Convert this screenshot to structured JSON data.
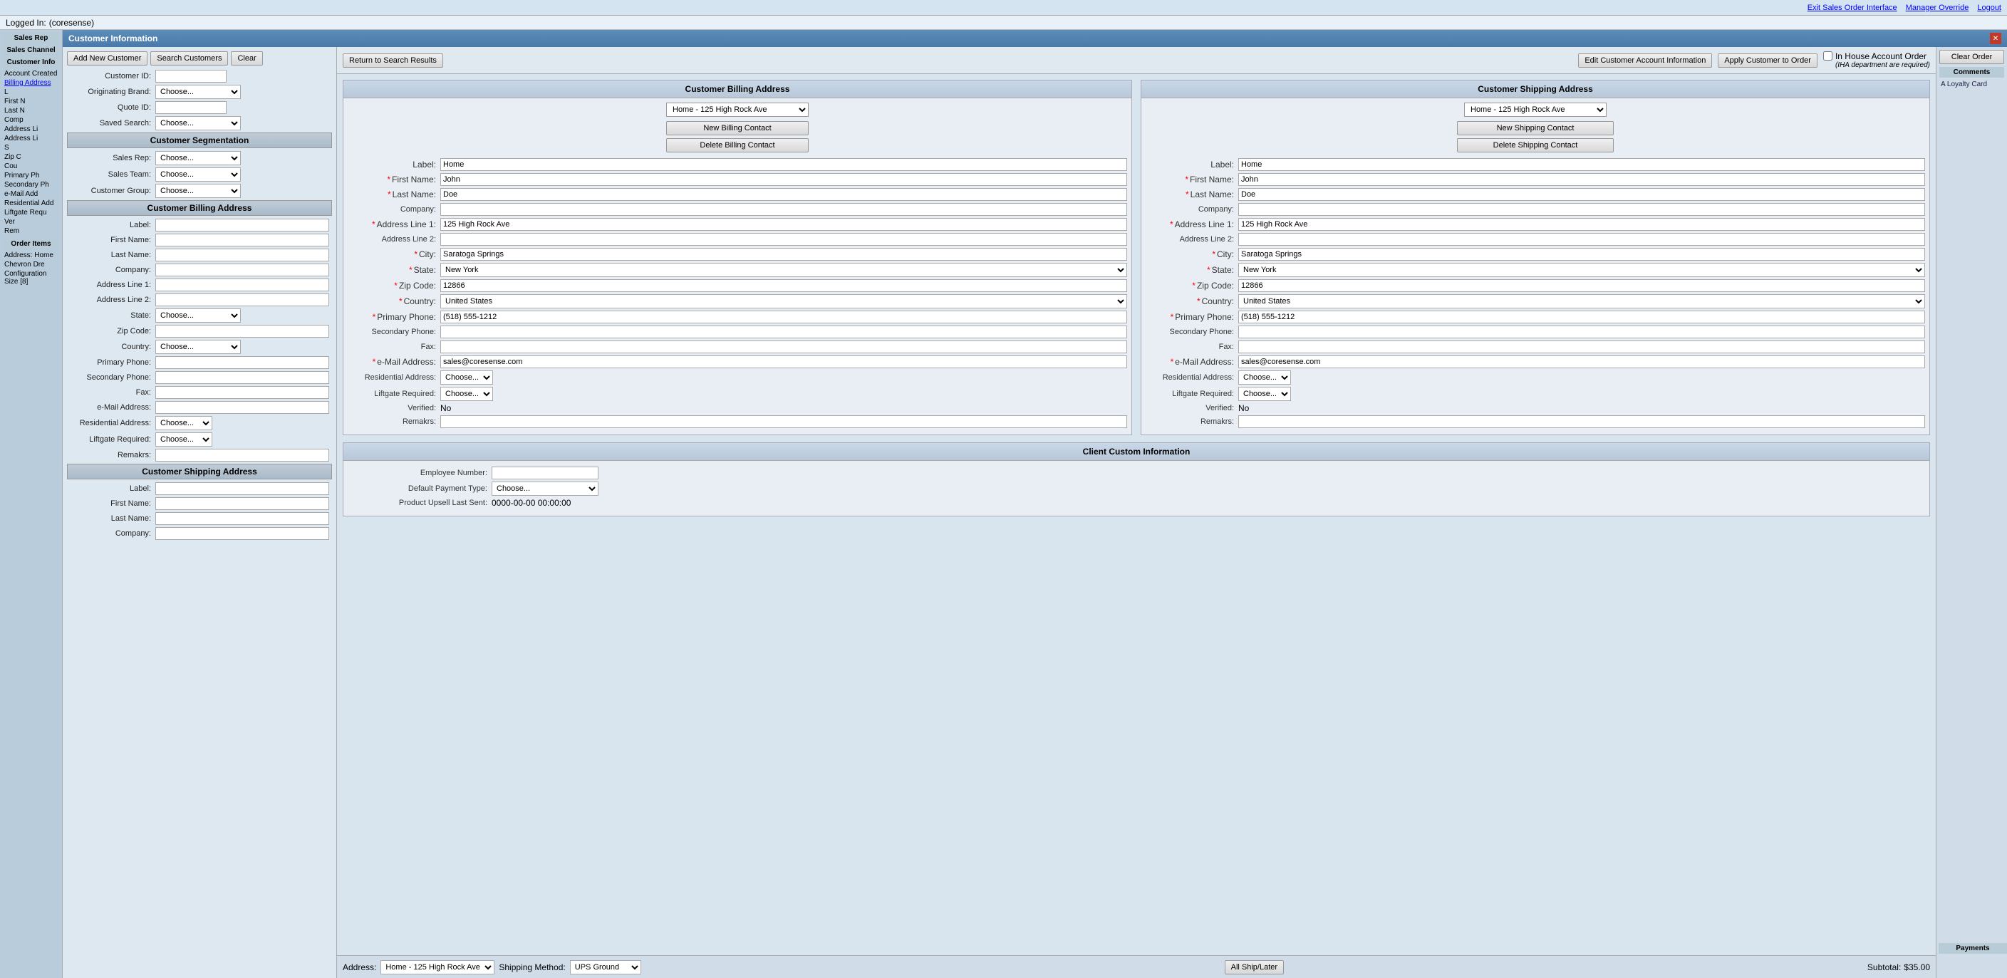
{
  "topBar": {
    "links": [
      "Exit Sales Order Interface",
      "Manager Override",
      "Logout"
    ]
  },
  "loggedIn": {
    "label": "Logged In:",
    "user": "(coresense)"
  },
  "leftSidebar": {
    "items": [
      "Sales Rep",
      "Sales Channel",
      "Customer Info",
      "Account Created",
      "Billing Address",
      "L",
      "First N",
      "Last N",
      "Comp",
      "Address Li",
      "Address Li",
      "S",
      "Zip C",
      "Cou",
      "Primary Ph",
      "Secondary Ph",
      "e-Mail Add",
      "Residential Add",
      "Liftgate Requ",
      "Ver",
      "Rem",
      "Order Items",
      "Address: Home",
      "Chevron Dre",
      "Configuration Size [8]"
    ]
  },
  "modal": {
    "title": "Customer Information",
    "buttons": {
      "addNew": "Add New Customer",
      "search": "Search Customers",
      "clear": "Clear"
    },
    "leftForm": {
      "customerIdLabel": "Customer ID:",
      "originatingBrandLabel": "Originating Brand:",
      "quoteIdLabel": "Quote ID:",
      "savedSearchLabel": "Saved Search:",
      "segmentation": {
        "header": "Customer Segmentation",
        "salesRepLabel": "Sales Rep:",
        "salesTeamLabel": "Sales Team:",
        "customerGroupLabel": "Customer Group:"
      },
      "billingAddress": {
        "header": "Customer Billing Address",
        "labelLabel": "Label:",
        "firstNameLabel": "First Name:",
        "lastNameLabel": "Last Name:",
        "companyLabel": "Company:",
        "addressLine1Label": "Address Line 1:",
        "addressLine2Label": "Address Line 2:",
        "stateLabel": "State:",
        "zipCodeLabel": "Zip Code:",
        "countryLabel": "Country:",
        "primaryPhoneLabel": "Primary Phone:",
        "secondaryPhoneLabel": "Secondary Phone:",
        "faxLabel": "Fax:",
        "eMailLabel": "e-Mail Address:",
        "residentialLabel": "Residential Address:",
        "liftgateLabel": "Liftgate Required:",
        "remarksLabel": "Remakrs:"
      },
      "shippingAddress": {
        "header": "Customer Shipping Address",
        "labelLabel": "Label:",
        "firstNameLabel": "First Name:",
        "lastNameLabel": "Last Name:",
        "companyLabel": "Company:"
      }
    },
    "rightPanel": {
      "returnBtn": "Return to Search Results",
      "editBtn": "Edit Customer Account Information",
      "applyBtn": "Apply Customer to Order",
      "ihaCheckbox": "In House Account Order",
      "ihaNote": "(IHA department are required)",
      "billing": {
        "header": "Customer Billing Address",
        "dropdown": "Home - 125 High Rock Ave",
        "newContact": "New Billing Contact",
        "deleteContact": "Delete Billing Contact",
        "fields": {
          "label": "Label:",
          "labelValue": "Home",
          "firstName": "First Name:",
          "firstNameValue": "John",
          "lastName": "Last Name:",
          "lastNameValue": "Doe",
          "company": "Company:",
          "companyValue": "",
          "addressLine1": "Address Line 1:",
          "addressLine1Value": "125 High Rock Ave",
          "addressLine2": "Address Line 2:",
          "addressLine2Value": "",
          "city": "City:",
          "cityValue": "Saratoga Springs",
          "state": "State:",
          "stateValue": "New York",
          "zipCode": "Zip Code:",
          "zipCodeValue": "12866",
          "country": "Country:",
          "countryValue": "United States",
          "primaryPhone": "Primary Phone:",
          "primaryPhoneValue": "(518) 555-1212",
          "secondaryPhone": "Secondary Phone:",
          "secondaryPhoneValue": "",
          "fax": "Fax:",
          "faxValue": "",
          "eMailAddress": "e-Mail Address:",
          "eMailValue": "sales@coresense.com",
          "residentialAddress": "Residential Address:",
          "residentialValue": "Choose...",
          "liftgateRequired": "Liftgate Required:",
          "liftgateValue": "Choose...",
          "verified": "Verified:",
          "verifiedValue": "No",
          "remakrs": "Remakrs:",
          "remakrsValue": ""
        }
      },
      "shipping": {
        "header": "Customer Shipping Address",
        "dropdown": "Home - 125 High Rock Ave",
        "newContact": "New Shipping Contact",
        "deleteContact": "Delete Shipping Contact",
        "fields": {
          "label": "Label:",
          "labelValue": "Home",
          "firstName": "First Name:",
          "firstNameValue": "John",
          "lastName": "Last Name:",
          "lastNameValue": "Doe",
          "company": "Company:",
          "companyValue": "",
          "addressLine1": "Address Line 1:",
          "addressLine1Value": "125 High Rock Ave",
          "addressLine2": "Address Line 2:",
          "addressLine2Value": "",
          "city": "City:",
          "cityValue": "Saratoga Springs",
          "state": "State:",
          "stateValue": "New York",
          "zipCode": "Zip Code:",
          "zipCodeValue": "12866",
          "country": "Country:",
          "countryValue": "United States",
          "primaryPhone": "Primary Phone:",
          "primaryPhoneValue": "(518) 555-1212",
          "secondaryPhone": "Secondary Phone:",
          "secondaryPhoneValue": "",
          "fax": "Fax:",
          "faxValue": "",
          "eMailAddress": "e-Mail Address:",
          "eMailValue": "sales@coresense.com",
          "residentialAddress": "Residential Address:",
          "residentialValue": "Choose...",
          "liftgateRequired": "Liftgate Required:",
          "liftgateValue": "Choose...",
          "verified": "Verified:",
          "verifiedValue": "No",
          "remakrs": "Remakrs:",
          "remakrsValue": ""
        }
      },
      "clientCustom": {
        "header": "Client Custom Information",
        "employeeNumber": "Employee Number:",
        "employeeNumberValue": "",
        "defaultPaymentType": "Default Payment Type:",
        "defaultPaymentValue": "Choose...",
        "productUpsell": "Product Upsell Last Sent:",
        "productUpsellValue": "0000-00-00 00:00:00"
      }
    },
    "bottomBar": {
      "shippingMethodLabel": "Shipping Method:",
      "shippingMethodValue": "UPS Ground",
      "addressLabel": "Address:",
      "addressValue": "Home - 125 High Rock Ave",
      "allShipLater": "All Ship/Later",
      "subtotalLabel": "Subtotal:",
      "subtotalValue": "$35.00"
    }
  },
  "farRight": {
    "clearOrderBtn": "Clear Order",
    "commentsLabel": "Comments",
    "loyaltyCard": "A Loyalty Card",
    "paymentsLabel": "Payments"
  }
}
